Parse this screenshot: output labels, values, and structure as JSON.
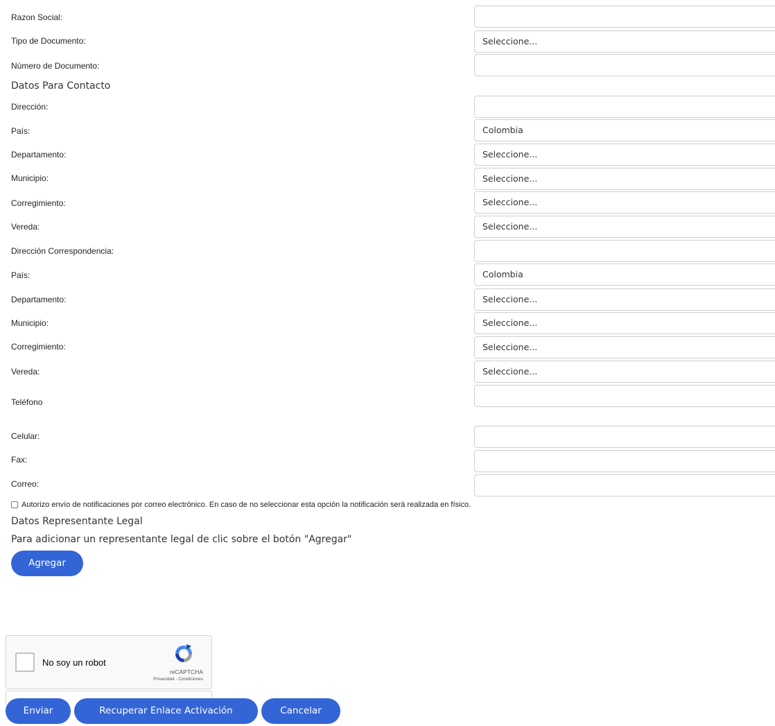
{
  "company": {
    "razon_social_label": "Razon Social:",
    "razon_social_value": "",
    "tipo_documento_label": "Tipo de Documento:",
    "tipo_documento_value": "Seleccione...",
    "numero_documento_label": "Número de Documento:",
    "numero_documento_value": ""
  },
  "contact": {
    "section_title": "Datos Para Contacto",
    "direccion_label": "Dirección:",
    "direccion_value": "",
    "pais_label": "País:",
    "pais_value": "Colombia",
    "departamento_label": "Departamento:",
    "departamento_value": "Seleccione...",
    "municipio_label": "Municipio:",
    "municipio_value": "Seleccione...",
    "corregimiento_label": "Corregimiento:",
    "corregimiento_value": "Seleccione...",
    "vereda_label": "Vereda:",
    "vereda_value": "Seleccione..."
  },
  "correspondence": {
    "direccion_label": "Dirección Correspondencia:",
    "direccion_value": "",
    "pais_label": "País:",
    "pais_value": "Colombia",
    "departamento_label": "Departamento:",
    "departamento_value": "Seleccione...",
    "municipio_label": "Municipio:",
    "municipio_value": "Seleccione...",
    "corregimiento_label": "Corregimiento:",
    "corregimiento_value": "Seleccione...",
    "vereda_label": "Vereda:",
    "vereda_value": "Seleccione..."
  },
  "phones": {
    "telefono_label": "Teléfono",
    "telefono_value": "",
    "celular_label": "Celular:",
    "celular_value": "",
    "fax_label": "Fax:",
    "fax_value": "",
    "correo_label": "Correo:",
    "correo_value": ""
  },
  "consent": {
    "text": "Autorizo envío de notificaciones por correo electrónico. En caso de no seleccionar esta opción la notificación será realizada en físico.",
    "checked": false
  },
  "legal_rep": {
    "section_title": "Datos Representante Legal",
    "instructions": "Para adicionar un representante legal de clic sobre el botón \"Agregar\"",
    "add_button": "Agregar"
  },
  "captcha": {
    "label": "No soy un robot",
    "brand": "reCAPTCHA",
    "links": "Privacidad - Condiciones",
    "icon": "recaptcha-icon"
  },
  "actions": {
    "submit": "Enviar",
    "recover": "Recuperar Enlace Activación",
    "cancel": "Cancelar"
  },
  "colors": {
    "button": "#3465d6",
    "field_border": "#cfcfcf"
  }
}
